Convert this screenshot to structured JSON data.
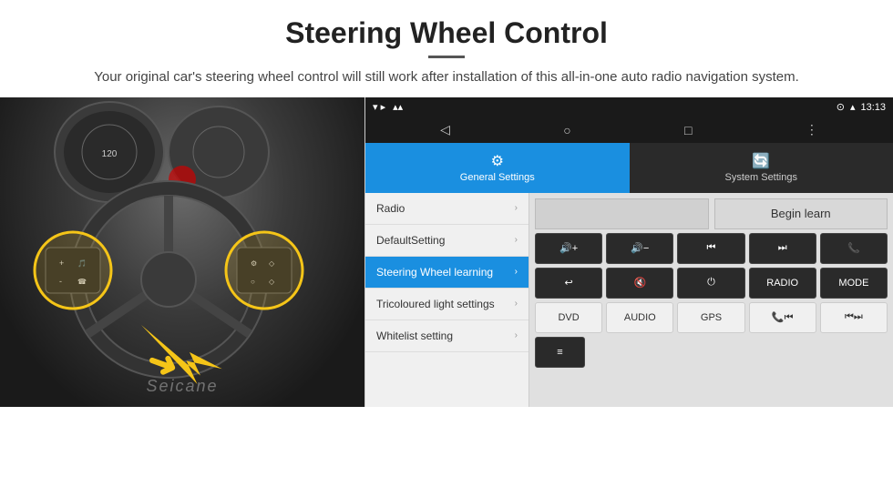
{
  "header": {
    "title": "Steering Wheel Control",
    "subtitle": "Your original car's steering wheel control will still work after installation of this all-in-one auto radio navigation system."
  },
  "status_bar": {
    "time": "13:13",
    "signal_icon": "wifi",
    "location_icon": "location"
  },
  "nav_bar": {
    "back_label": "◁",
    "home_label": "○",
    "recent_label": "□",
    "menu_label": "⋮"
  },
  "tabs": {
    "general": "General Settings",
    "system": "System Settings"
  },
  "menu": {
    "items": [
      {
        "label": "Radio",
        "active": false
      },
      {
        "label": "DefaultSetting",
        "active": false
      },
      {
        "label": "Steering Wheel learning",
        "active": true
      },
      {
        "label": "Tricoloured light settings",
        "active": false
      },
      {
        "label": "Whitelist setting",
        "active": false
      }
    ]
  },
  "right_panel": {
    "begin_learn_label": "Begin learn",
    "buttons": {
      "row1": [
        "🔊+",
        "🔊−",
        "⏮",
        "⏭",
        "📞"
      ],
      "row2": [
        "↩",
        "🔇",
        "⏻",
        "RADIO",
        "MODE"
      ],
      "row3": [
        "DVD",
        "AUDIO",
        "GPS",
        "📞⏮",
        "⏮⏭"
      ],
      "row4": [
        "≡"
      ]
    }
  },
  "watermark": "Seicane"
}
